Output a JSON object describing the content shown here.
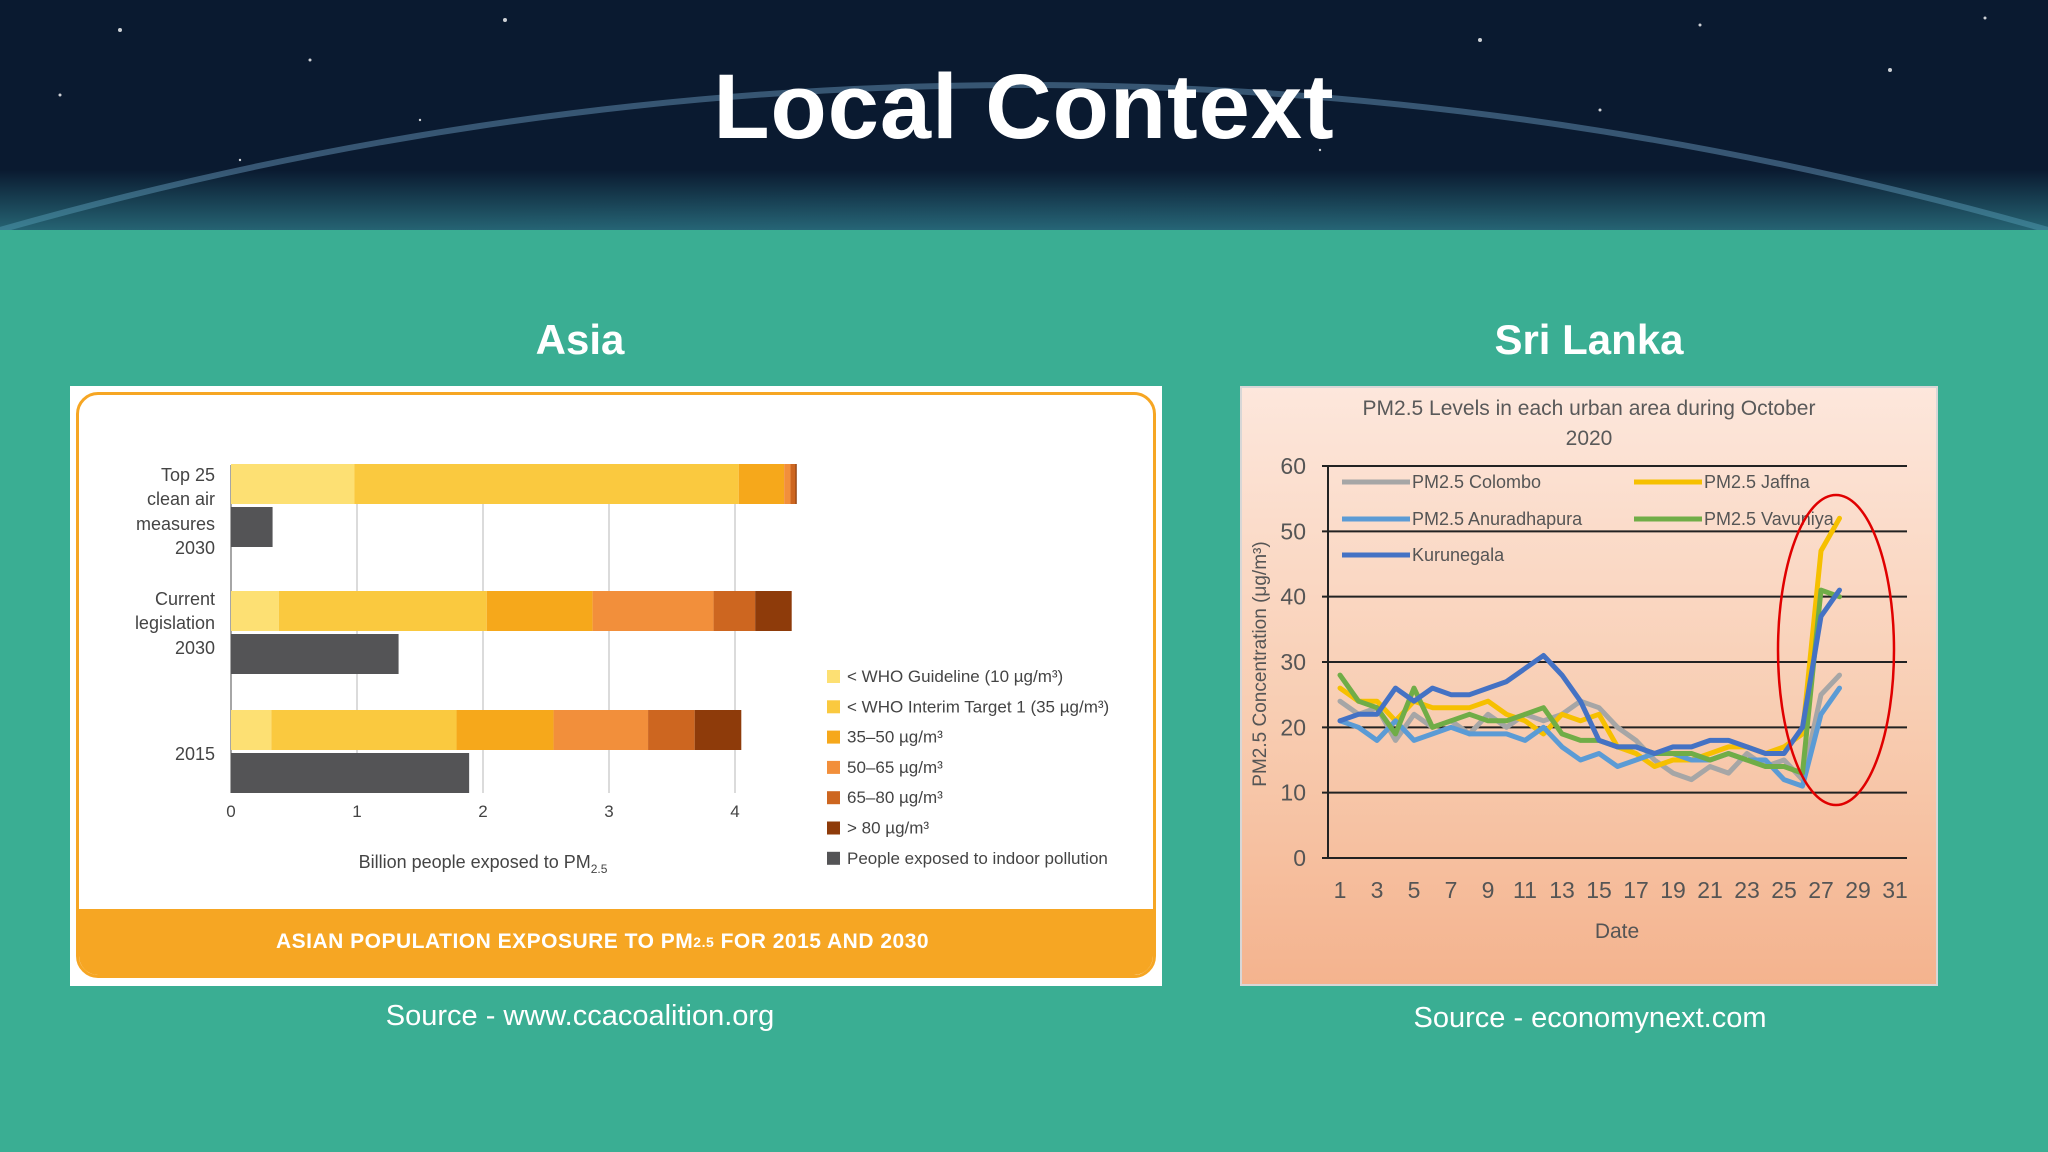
{
  "slide": {
    "title": "Local Context",
    "asia_heading": "Asia",
    "srilanka_heading": "Sri Lanka",
    "asia_source": "Source - www.ccacoalition.org",
    "srilanka_source": "Source - economynext.com"
  },
  "colors": {
    "background": "#3aae93",
    "accent_orange": "#f6a623",
    "annotation_circle": "#e00000"
  },
  "chart_data": [
    {
      "type": "bar",
      "orientation": "horizontal-stacked",
      "banner_title": "ASIAN POPULATION EXPOSURE TO PM",
      "banner_title_sub": "2.5",
      "banner_title_rest": " FOR 2015 AND 2030",
      "xlabel": "Billion people exposed to PM",
      "xlabel_sub": "2.5",
      "xlim": [
        0,
        4.4
      ],
      "xticks": [
        "0",
        "1",
        "2",
        "3",
        "4"
      ],
      "groups": [
        {
          "label_lines": [
            "Top 25",
            "clean air",
            "measures",
            "2030"
          ],
          "stack": [
            0.98,
            3.05,
            0.36,
            0.05,
            0.04,
            0.01
          ],
          "indoor": 0.33
        },
        {
          "label_lines": [
            "Current",
            "legislation",
            "2030"
          ],
          "stack": [
            0.38,
            1.65,
            0.84,
            0.96,
            0.33,
            0.29
          ],
          "indoor": 1.33
        },
        {
          "label_lines": [
            "2015"
          ],
          "stack": [
            0.32,
            1.47,
            0.77,
            0.75,
            0.37,
            0.37
          ],
          "indoor": 1.89
        }
      ],
      "segment_colors": [
        "#fde073",
        "#fac93f",
        "#f6a81b",
        "#f28f3b",
        "#cd6620",
        "#8e3b0a"
      ],
      "indoor_color": "#545456",
      "legend": [
        {
          "color": "#fde073",
          "label": "< WHO Guideline (10 µg/m³)"
        },
        {
          "color": "#fac93f",
          "label": "< WHO Interim Target 1 (35 µg/m³)"
        },
        {
          "color": "#f6a81b",
          "label": "35–50 µg/m³"
        },
        {
          "color": "#f28f3b",
          "label": "50–65 µg/m³"
        },
        {
          "color": "#cd6620",
          "label": "65–80 µg/m³"
        },
        {
          "color": "#8e3b0a",
          "label": "> 80 µg/m³"
        },
        {
          "color": "#545456",
          "label": "People exposed to indoor pollution"
        }
      ]
    },
    {
      "type": "line",
      "title_lines": [
        "PM2.5 Levels in each urban area during October",
        "2020"
      ],
      "xlabel": "Date",
      "ylabel": "PM2.5 Concentration (μg/m³)",
      "ylim": [
        0,
        60
      ],
      "yticks": [
        "0",
        "10",
        "20",
        "30",
        "40",
        "50",
        "60"
      ],
      "xticks": [
        "1",
        "3",
        "5",
        "7",
        "9",
        "11",
        "13",
        "15",
        "17",
        "19",
        "21",
        "23",
        "25",
        "27",
        "29",
        "31"
      ],
      "x": [
        1,
        2,
        3,
        4,
        5,
        6,
        7,
        8,
        9,
        10,
        11,
        12,
        13,
        14,
        15,
        16,
        17,
        18,
        19,
        20,
        21,
        22,
        23,
        24,
        25,
        26,
        27,
        28
      ],
      "series": [
        {
          "name": "PM2.5 Colombo",
          "color": "#a6a6a6",
          "values": [
            24,
            22,
            23,
            18,
            22,
            20,
            21,
            19,
            22,
            20,
            22,
            21,
            22,
            24,
            23,
            20,
            18,
            15,
            13,
            12,
            14,
            13,
            16,
            14,
            15,
            12,
            25,
            28
          ]
        },
        {
          "name": "PM2.5 Jaffna",
          "color": "#f6c000",
          "values": [
            26,
            24,
            24,
            21,
            24,
            23,
            23,
            23,
            24,
            22,
            21,
            19,
            22,
            21,
            22,
            17,
            16,
            14,
            15,
            15,
            16,
            17,
            17,
            16,
            17,
            19,
            47,
            52
          ]
        },
        {
          "name": "PM2.5 Anuradhapura",
          "color": "#5b9bd5",
          "values": [
            21,
            20,
            18,
            21,
            18,
            19,
            20,
            19,
            19,
            19,
            18,
            20,
            17,
            15,
            16,
            14,
            15,
            16,
            16,
            15,
            15,
            16,
            15,
            15,
            12,
            11,
            22,
            26
          ]
        },
        {
          "name": "PM2.5 Vavuniya",
          "color": "#70ad47",
          "values": [
            28,
            24,
            23,
            19,
            26,
            20,
            21,
            22,
            21,
            21,
            22,
            23,
            19,
            18,
            18,
            17,
            17,
            16,
            16,
            16,
            15,
            16,
            15,
            14,
            14,
            13,
            41,
            40
          ]
        },
        {
          "name": "Kurunegala",
          "color": "#4472c4",
          "values": [
            21,
            22,
            22,
            26,
            24,
            26,
            25,
            25,
            26,
            27,
            29,
            31,
            28,
            24,
            18,
            17,
            17,
            16,
            17,
            17,
            18,
            18,
            17,
            16,
            16,
            20,
            37,
            41
          ]
        }
      ],
      "legend_placement": "top-left inside plot",
      "grid": "horizontal",
      "annotation": "red ellipse around days 26–28"
    }
  ]
}
